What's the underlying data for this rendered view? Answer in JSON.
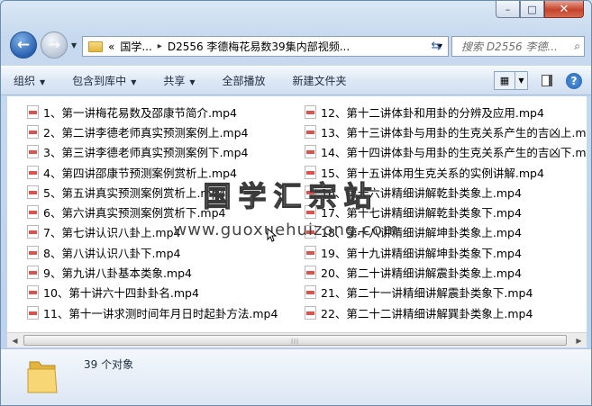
{
  "window": {
    "buttons": {
      "minimize": "–",
      "maximize": "□",
      "close": "✕"
    }
  },
  "nav": {
    "back_icon": "arrow-left-icon",
    "forward_icon": "arrow-right-icon",
    "address": {
      "prefix": "«",
      "segments": [
        "国学...",
        "D2556 李德梅花易数39集内部视频..."
      ],
      "separator": "▸"
    },
    "search_placeholder": "搜索 D2556 李德..."
  },
  "toolbar": {
    "items": [
      "组织",
      "包含到库中",
      "共享",
      "全部播放",
      "新建文件夹"
    ],
    "dropdowns": [
      true,
      true,
      true,
      false,
      false
    ]
  },
  "files_left": [
    "1、第一讲梅花易数及邵康节简介.mp4",
    "2、第二讲李德老师真实预测案例上.mp4",
    "3、第三讲李德老师真实预测案例下.mp4",
    "4、第四讲邵康节预测案例赏析上.mp4",
    "5、第五讲真实预测案例赏析上.mp4",
    "6、第六讲真实预测案例赏析下.mp4",
    "7、第七讲认识八卦上.mp4",
    "8、第八讲认识八卦下.mp4",
    "9、第九讲八卦基本类象.mp4",
    "10、第十讲六十四卦卦名.mp4",
    "11、第十一讲求测时间年月日时起卦方法.mp4"
  ],
  "files_right": [
    "12、第十二讲体卦和用卦的分辨及应用.mp4",
    "13、第十三讲体卦与用卦的生克关系产生的吉凶上.mp4",
    "14、第十四讲体卦与用卦的生克关系产生的吉凶下.mp4",
    "15、第十五讲体用生克关系的实例讲解.mp4",
    "16、第十六讲精细讲解乾卦类象上.mp4",
    "17、第十七讲精细讲解乾卦类象下.mp4",
    "18、第十八讲精细讲解坤卦类象上.mp4",
    "19、第十九讲精细讲解坤卦类象下.mp4",
    "20、第二十讲精细讲解震卦类象上.mp4",
    "21、第二十一讲精细讲解震卦类象下.mp4",
    "22、第二十二讲精细讲解巽卦类象上.mp4"
  ],
  "watermark": {
    "title": "国学汇宗站",
    "url": "www.guoxuehuizong.com"
  },
  "details": {
    "count_text": "39 个对象"
  },
  "colors": {
    "accent": "#2a62b1",
    "file_icon_red": "#d9534f"
  }
}
